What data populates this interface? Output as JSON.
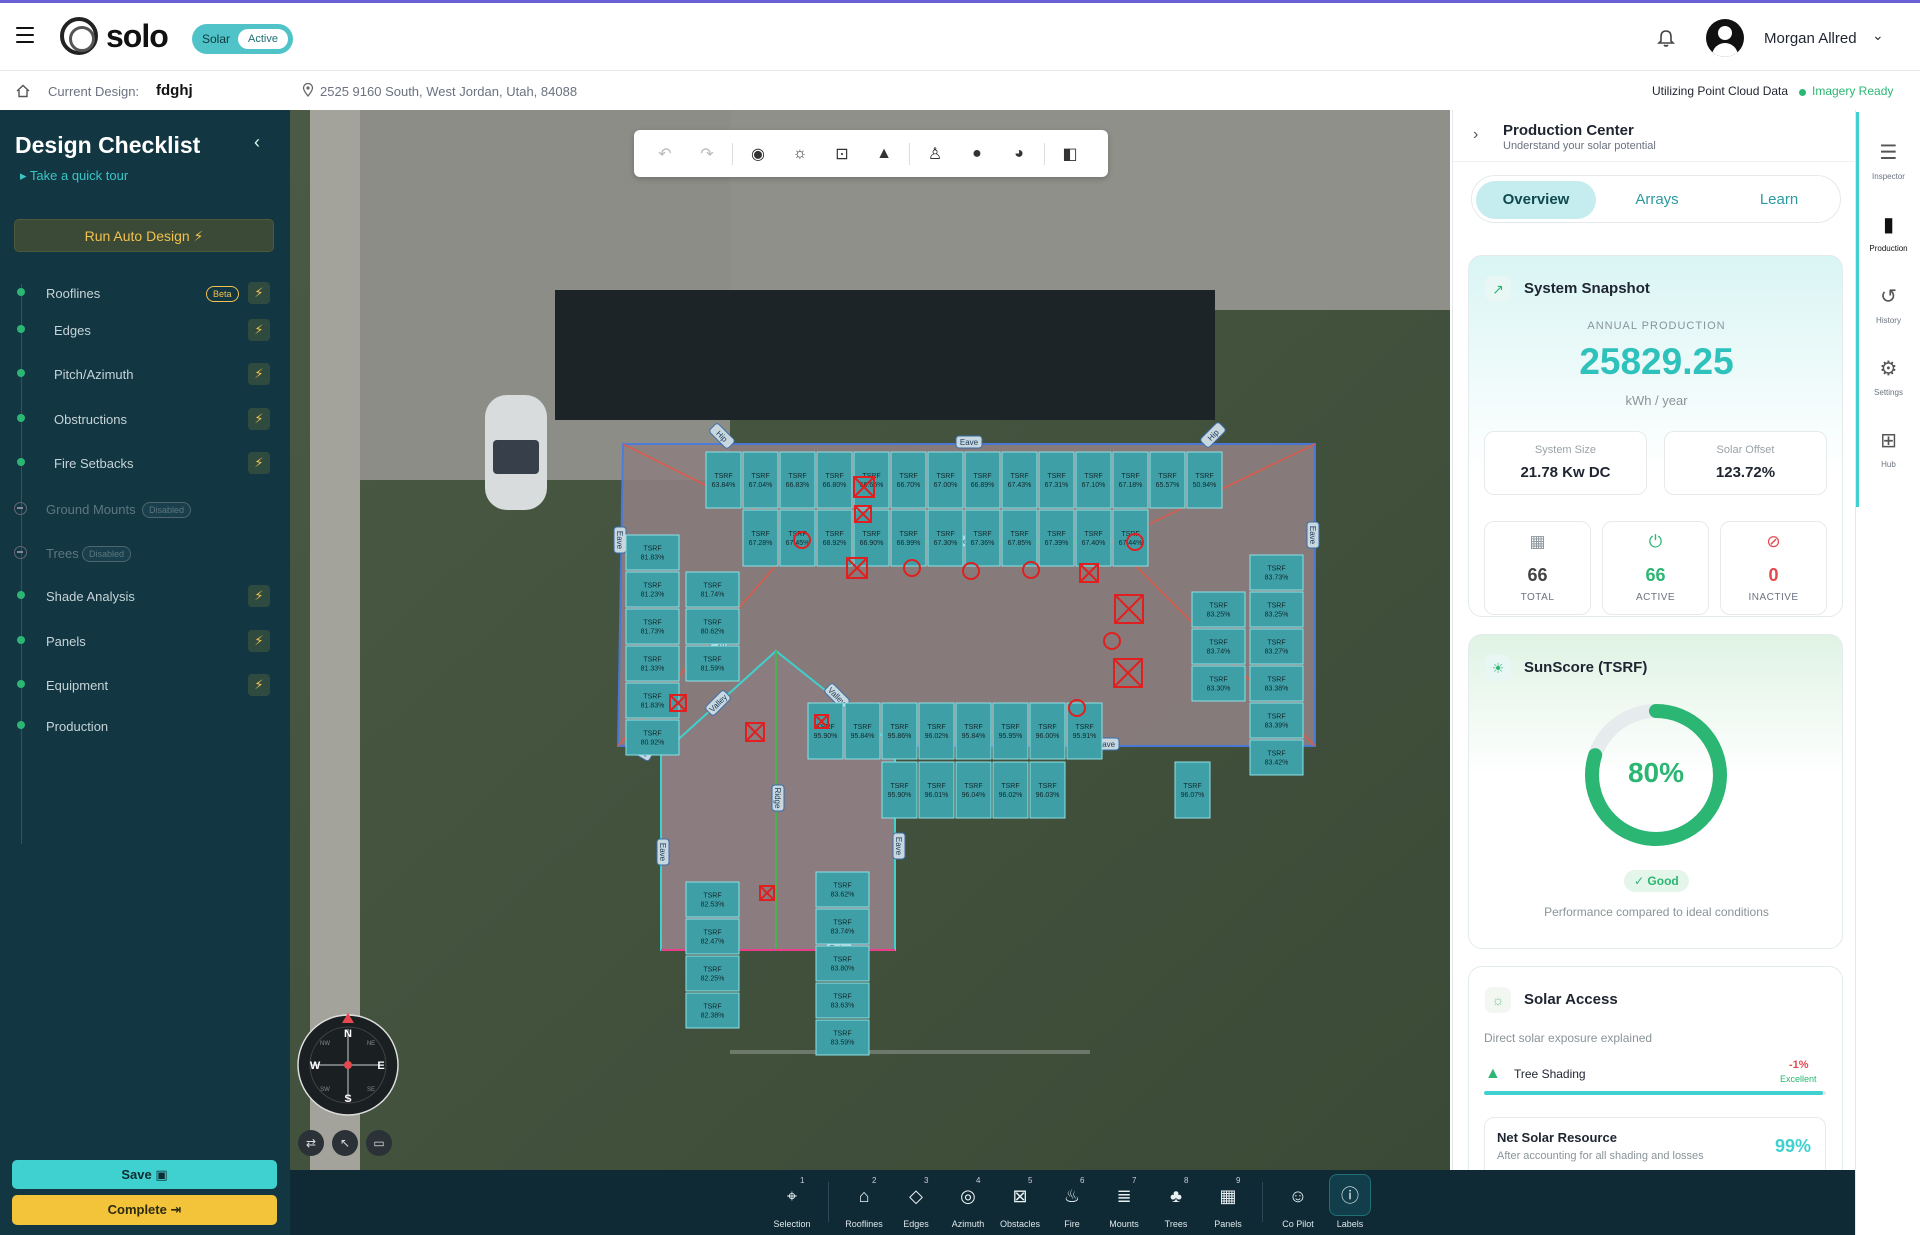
{
  "app": {
    "logo_text": "solo",
    "plan_name": "Solar",
    "plan_status": "Active",
    "user_name": "Morgan Allred"
  },
  "subbar": {
    "current_design_label": "Current Design:",
    "current_design_value": "fdghj",
    "address": "2525 9160 South, West Jordan, Utah, 84088",
    "point_cloud_label": "Utilizing Point Cloud Data",
    "imagery_status": "Imagery Ready"
  },
  "checklist": {
    "title": "Design Checklist",
    "tour_link": "Take a quick tour",
    "auto_design_label": "Run Auto Design",
    "items": [
      {
        "label": "Rooflines",
        "badge": "Beta"
      },
      {
        "label": "Edges"
      },
      {
        "label": "Pitch/Azimuth"
      },
      {
        "label": "Obstructions"
      },
      {
        "label": "Fire Setbacks"
      },
      {
        "label": "Ground Mounts",
        "badge": "Disabled"
      },
      {
        "label": "Trees",
        "badge": "Disabled"
      },
      {
        "label": "Shade Analysis"
      },
      {
        "label": "Panels"
      },
      {
        "label": "Equipment"
      },
      {
        "label": "Production"
      }
    ],
    "save_label": "Save",
    "complete_label": "Complete"
  },
  "map": {
    "edge_labels": {
      "eave": "Eave",
      "hip": "Hip",
      "ridge": "Ridge",
      "valley": "Valley",
      "rake": "Rake"
    },
    "panel_label": "TSRF",
    "compass": {
      "n": "N",
      "s": "S",
      "e": "E",
      "w": "W",
      "ne": "NE",
      "nw": "NW",
      "se": "SE",
      "sw": "SW"
    },
    "panels_top_row1": [
      "63.84%",
      "67.04%",
      "66.83%",
      "66.80%",
      "66.65%",
      "66.70%",
      "67.00%",
      "66.89%",
      "67.43%",
      "67.31%",
      "67.10%",
      "67.18%",
      "65.57%",
      "50.94%"
    ],
    "panels_top_row2": [
      "67.28%",
      "67.45%",
      "68.92%",
      "66.90%",
      "66.99%",
      "67.30%",
      "67.36%",
      "67.85%",
      "67.39%",
      "67.40%",
      "67.44%"
    ],
    "panels_west_col1": [
      "81.83%",
      "81.23%",
      "81.73%",
      "81.33%",
      "81.83%",
      "80.92%"
    ],
    "panels_west_col2": [
      "81.74%",
      "80.62%",
      "81.59%"
    ],
    "panels_south_row1": [
      "95.90%",
      "95.84%",
      "95.86%",
      "96.02%",
      "95.84%",
      "95.95%",
      "96.00%",
      "95.91%"
    ],
    "panels_south_row2": [
      "95.90%",
      "96.01%",
      "96.04%",
      "96.02%",
      "96.03%"
    ],
    "panels_south_single": [
      "96.07%"
    ],
    "panels_east_col1": [
      "83.25%",
      "83.74%",
      "83.30%"
    ],
    "panels_east_col2": [
      "83.73%",
      "83.25%",
      "83.27%",
      "83.38%",
      "83.39%",
      "83.42%"
    ],
    "panels_wing_left": [
      "82.53%",
      "82.47%",
      "82.25%",
      "82.38%"
    ],
    "panels_wing_right": [
      "83.62%",
      "83.74%",
      "83.80%",
      "83.63%",
      "83.59%"
    ]
  },
  "toolbar": {
    "undo_icon": "undo-icon",
    "redo_icon": "redo-icon",
    "tools": [
      "target-icon",
      "sun-icon",
      "focus-icon",
      "terrain-icon",
      "person-icon",
      "sphere-icon",
      "shade-icon",
      "split-view-icon"
    ]
  },
  "dock": {
    "items": [
      {
        "label": "Selection",
        "num": "1",
        "icon": "⌖"
      },
      {
        "label": "Rooflines",
        "num": "2",
        "icon": "⌂"
      },
      {
        "label": "Edges",
        "num": "3",
        "icon": "◇"
      },
      {
        "label": "Azimuth",
        "num": "4",
        "icon": "◎"
      },
      {
        "label": "Obstacles",
        "num": "5",
        "icon": "⊠"
      },
      {
        "label": "Fire",
        "num": "6",
        "icon": "♨"
      },
      {
        "label": "Mounts",
        "num": "7",
        "icon": "≣"
      },
      {
        "label": "Trees",
        "num": "8",
        "icon": "♣"
      },
      {
        "label": "Panels",
        "num": "9",
        "icon": "▦"
      },
      {
        "label": "Co Pilot",
        "num": "",
        "icon": "☺"
      },
      {
        "label": "Labels",
        "num": "",
        "icon": "ⓘ"
      }
    ]
  },
  "production": {
    "title": "Production Center",
    "subtitle": "Understand your solar potential",
    "tabs": [
      "Overview",
      "Arrays",
      "Learn"
    ],
    "snapshot": {
      "title": "System Snapshot",
      "annual_label": "ANNUAL PRODUCTION",
      "annual_value": "25829.25",
      "annual_unit": "kWh / year",
      "system_size_label": "System Size",
      "system_size_value": "21.78 Kw DC",
      "solar_offset_label": "Solar Offset",
      "solar_offset_value": "123.72%",
      "total_value": "66",
      "total_label": "TOTAL",
      "active_value": "66",
      "active_label": "ACTIVE",
      "inactive_value": "0",
      "inactive_label": "INACTIVE"
    },
    "sunscore": {
      "title": "SunScore (TSRF)",
      "value": "80%",
      "fraction": 0.8,
      "rating": "Good",
      "caption": "Performance compared to ideal conditions"
    },
    "access": {
      "title": "Solar Access",
      "subtitle": "Direct solar exposure explained",
      "tree_label": "Tree Shading",
      "tree_value": "-1%",
      "tree_rating": "Excellent",
      "tree_fraction": 0.99,
      "nsr_title": "Net Solar Resource",
      "nsr_sub": "After accounting for all shading and losses",
      "nsr_value": "99%"
    }
  },
  "rail": {
    "items": [
      "Inspector",
      "Production",
      "History",
      "Settings",
      "Hub"
    ]
  }
}
